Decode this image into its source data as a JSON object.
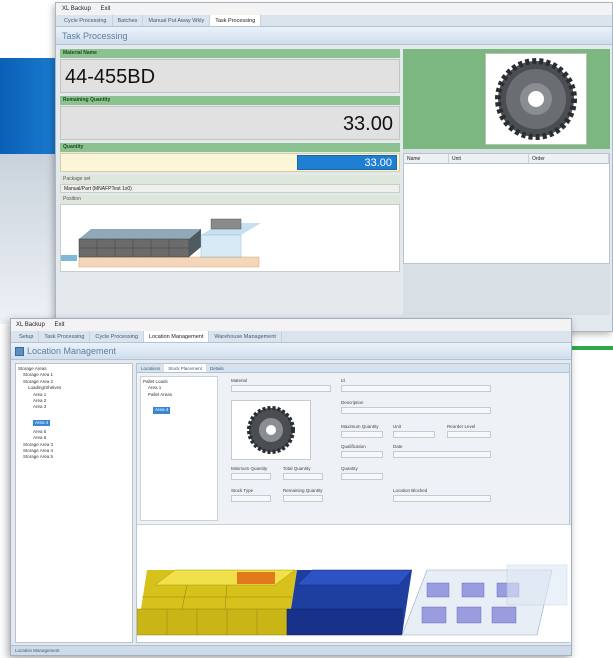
{
  "window1": {
    "menu": [
      "XL Backup",
      "Exit"
    ],
    "tabs": [
      "Cycle Processing",
      "Batches",
      "Manual Put Away Wkly",
      "Task Processing"
    ],
    "active_tab_index": 3,
    "title": "Task Processing",
    "part_label": "Material Name",
    "part_number": "44-455BD",
    "remaining_label": "Remaining Quantity",
    "remaining_value": "33.00",
    "quantity_label": "Quantity",
    "quantity_value": "33.00",
    "package_label": "Package set",
    "package_value": "Manual/Part (MNAFPTest 1x0)",
    "position_label": "Position",
    "grid_columns": [
      "Name",
      "Unit",
      "Order"
    ]
  },
  "window2": {
    "menu": [
      "XL Backup",
      "Exit"
    ],
    "tabs": [
      "Setup",
      "Task Processing",
      "Cycle Processing",
      "Location Management",
      "Warehouse Management"
    ],
    "active_tab_index": 3,
    "title": "Location Management",
    "tree": [
      {
        "label": "Storage Areas",
        "indent": 0
      },
      {
        "label": "Storage Area 1",
        "indent": 1
      },
      {
        "label": "Storage Area 2",
        "indent": 1
      },
      {
        "label": "Loading/Shelves",
        "indent": 2
      },
      {
        "label": "Area 1",
        "indent": 3
      },
      {
        "label": "Area 2",
        "indent": 3
      },
      {
        "label": "Area 3",
        "indent": 3
      },
      {
        "label": "Area 4",
        "indent": 3,
        "selected": true
      },
      {
        "label": "Area 5",
        "indent": 3
      },
      {
        "label": "Area 6",
        "indent": 3
      },
      {
        "label": "Storage Area 3",
        "indent": 1
      },
      {
        "label": "Storage Area 4",
        "indent": 1
      },
      {
        "label": "Storage Area 5",
        "indent": 1
      }
    ],
    "inner_tabs": [
      "Locations",
      "Stock Placement",
      "Details"
    ],
    "active_inner_tab_index": 1,
    "inner_tree": [
      "Pallet Loads",
      "Area 1",
      "Pallet Areas",
      "Area 4"
    ],
    "form": {
      "material_label": "Material",
      "id_label": "Id",
      "description_label": "Description",
      "min_quantity_label": "Minimum Quantity",
      "max_quantity_label": "Maximum Quantity",
      "reorder_label": "Reorder Level",
      "remaining_qty_label": "Remaining Quantity",
      "total_qty_label": "Total Quantity",
      "quantity_label": "Quantity",
      "unit_label": "Unit",
      "stock_type_label": "Stock Type",
      "flags_label": "Qualification",
      "date_label": "Date",
      "checkbox_label": "Location Blocked"
    },
    "status_text": "Location Management"
  },
  "colors": {
    "accent_blue": "#1f7fd2",
    "header_green": "#8bc28f",
    "bin_yellow": "#e6d21e",
    "bin_blue": "#1f3fa0",
    "bin_orange": "#e07a1a"
  }
}
